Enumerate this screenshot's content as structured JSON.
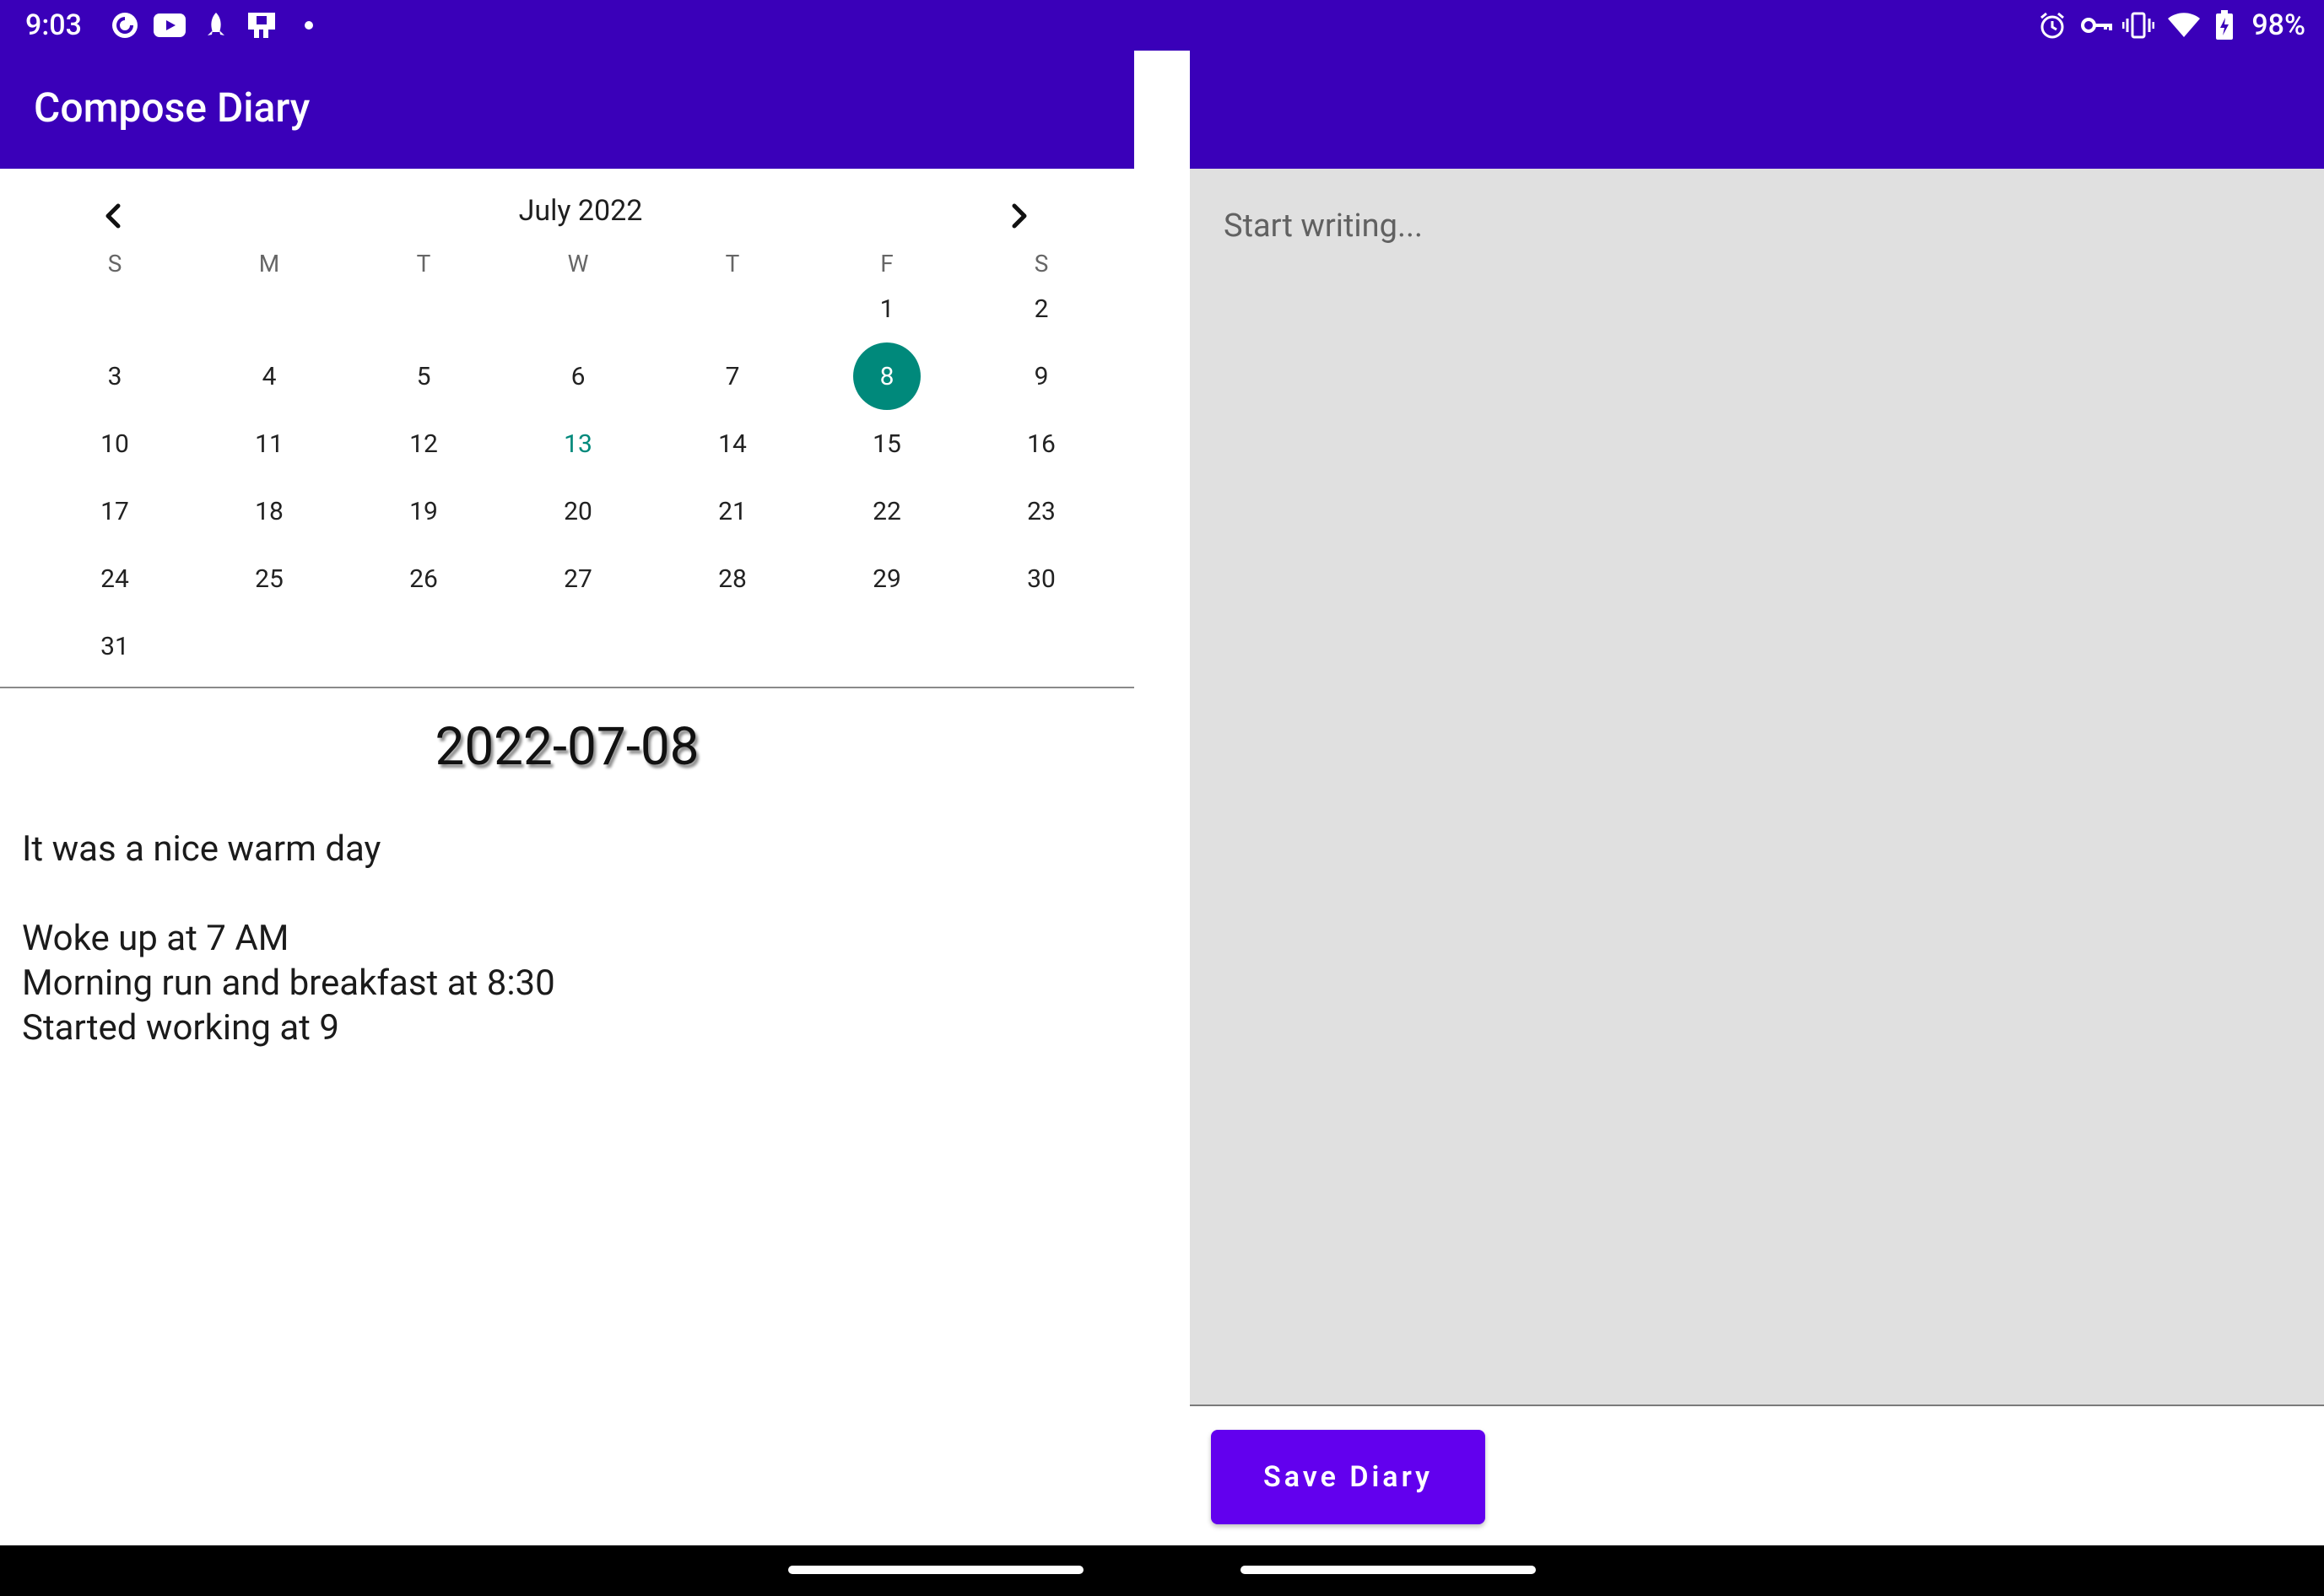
{
  "status_bar": {
    "time": "9:03",
    "battery": "98%",
    "left_icons": [
      "pocket-casts-icon",
      "youtube-icon",
      "rocket-icon",
      "cast-icon",
      "dot-icon"
    ],
    "right_icons": [
      "alarm-icon",
      "vpn-key-icon",
      "vibrate-icon",
      "wifi-icon",
      "battery-charging-icon"
    ],
    "bg_color": "#3a00b9"
  },
  "app": {
    "title": "Compose Diary",
    "primary_color": "#3a00b9",
    "accent_color": "#00897b",
    "button_color": "#6200ee"
  },
  "calendar": {
    "month_label": "July 2022",
    "weekday_headers": [
      "S",
      "M",
      "T",
      "W",
      "T",
      "F",
      "S"
    ],
    "weeks": [
      [
        "",
        "",
        "",
        "",
        "",
        "1",
        "2"
      ],
      [
        "3",
        "4",
        "5",
        "6",
        "7",
        "8",
        "9"
      ],
      [
        "10",
        "11",
        "12",
        "13",
        "14",
        "15",
        "16"
      ],
      [
        "17",
        "18",
        "19",
        "20",
        "21",
        "22",
        "23"
      ],
      [
        "24",
        "25",
        "26",
        "27",
        "28",
        "29",
        "30"
      ],
      [
        "31",
        "",
        "",
        "",
        "",
        "",
        ""
      ]
    ],
    "selected_day": "8",
    "today_day": "13"
  },
  "entry": {
    "date": "2022-07-08",
    "text": "It was a nice warm day\n\nWoke up at 7 AM\nMorning run and breakfast at 8:30\nStarted working at 9"
  },
  "editor": {
    "placeholder": "Start writing...",
    "value": ""
  },
  "actions": {
    "save_label": "Save Diary"
  }
}
